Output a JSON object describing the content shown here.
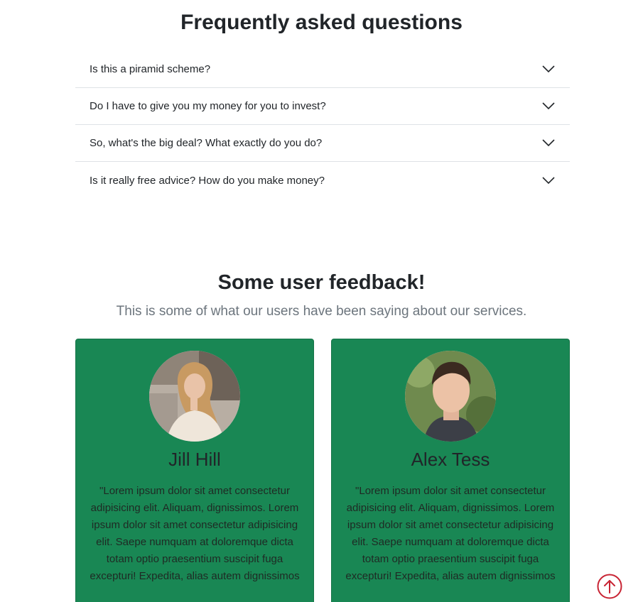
{
  "faq": {
    "title": "Frequently asked questions",
    "items": [
      {
        "question": "Is this a piramid scheme?"
      },
      {
        "question": "Do I have to give you my money for you to invest?"
      },
      {
        "question": "So, what's the big deal? What exactly do you do?"
      },
      {
        "question": "Is it really free advice? How do you make money?"
      }
    ]
  },
  "feedback": {
    "title": "Some user feedback!",
    "subtitle": "This is some of what our users have been saying about our services.",
    "cards": [
      {
        "name": "Jill Hill",
        "quote": "\"Lorem ipsum dolor sit amet consectetur adipisicing elit. Aliquam, dignissimos. Lorem ipsum dolor sit amet consectetur adipisicing elit. Saepe numquam at doloremque dicta totam optio praesentium suscipit fuga excepturi! Expedita, alias autem dignissimos"
      },
      {
        "name": "Alex Tess",
        "quote": "\"Lorem ipsum dolor sit amet consectetur adipisicing elit. Aliquam, dignissimos. Lorem ipsum dolor sit amet consectetur adipisicing elit. Saepe numquam at doloremque dicta totam optio praesentium suscipit fuga excepturi! Expedita, alias autem dignissimos"
      }
    ]
  },
  "colors": {
    "card_bg": "#198754",
    "scroll_top": "#c82333"
  },
  "icons": {
    "accordion_toggle": "chevron-down-icon",
    "scroll_top": "arrow-up-circle-icon"
  }
}
